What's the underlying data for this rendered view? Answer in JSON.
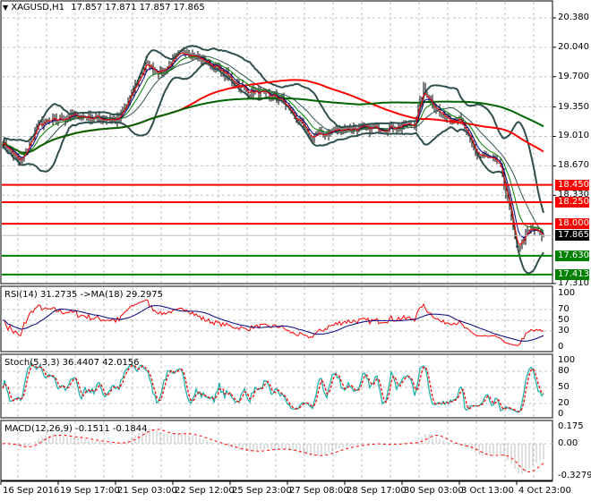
{
  "header": {
    "symbol": "XAGUSD,H1",
    "ohlc": "17.857 17.871 17.857 17.865"
  },
  "colors": {
    "bars": "#000000",
    "resistance": "#ff0000",
    "support": "#008000",
    "bollinger": "#2f4f4f",
    "ma_fast": "#ff0000",
    "ma_mid": "#000080",
    "ma_slow": "#008000",
    "ma_long": "#ff0000",
    "ma_longest": "#006400",
    "rsi": "#ff0000",
    "rsi_ma": "#000080",
    "stoch_main": "#20b2aa",
    "stoch_signal": "#ff0000",
    "macd_hist": "#c0c0c0",
    "macd_signal": "#ff0000"
  },
  "price_axis": [
    "20.380",
    "20.040",
    "19.700",
    "19.350",
    "19.010",
    "18.670",
    "18.330",
    "17.310"
  ],
  "price_axis_values": [
    20.38,
    20.04,
    19.7,
    19.35,
    19.01,
    18.67,
    18.33,
    17.31
  ],
  "levels": [
    {
      "label": "18.450",
      "value": 18.45,
      "type": "resistance"
    },
    {
      "label": "18.250",
      "value": 18.25,
      "type": "resistance"
    },
    {
      "label": "18.000",
      "value": 18.0,
      "type": "resistance"
    },
    {
      "label": "17.630",
      "value": 17.63,
      "type": "support"
    },
    {
      "label": "17.413",
      "value": 17.413,
      "type": "support"
    }
  ],
  "current_price": {
    "label": "17.865",
    "value": 17.865
  },
  "rsi": {
    "title": "RSI(14) 31.2735  ->MA(18) 29.2975",
    "axis": [
      "100",
      "70",
      "50",
      "30",
      "0"
    ],
    "axis_values": [
      100,
      70,
      50,
      30,
      0
    ]
  },
  "stoch": {
    "title": "Stoch(5,3,3) 36.4407 42.0156",
    "axis": [
      "100",
      "80",
      "50",
      "20",
      "0"
    ],
    "axis_values": [
      100,
      80,
      50,
      20,
      0
    ]
  },
  "macd": {
    "title": "MACD(12,26,9) -0.1511 -0.1844",
    "axis": [
      "0.175",
      "0.00",
      "-0.3279"
    ],
    "axis_values": [
      0.175,
      0,
      -0.3279
    ]
  },
  "time_axis": [
    "16 Sep 2016",
    "19 Sep 17:00",
    "21 Sep 03:00",
    "22 Sep 12:00",
    "25 Sep 23:00",
    "27 Sep 08:00",
    "28 Sep 17:00",
    "30 Sep 03:00",
    "3 Oct 13:00",
    "4 Oct 23:00"
  ],
  "chart_data": {
    "type": "ohlc-bars",
    "timeframe": "H1",
    "anchor_closes": [
      [
        0,
        18.95
      ],
      [
        10,
        18.7
      ],
      [
        20,
        19.15
      ],
      [
        40,
        19.25
      ],
      [
        65,
        19.2
      ],
      [
        80,
        19.85
      ],
      [
        88,
        19.75
      ],
      [
        102,
        20.0
      ],
      [
        120,
        19.8
      ],
      [
        135,
        19.55
      ],
      [
        155,
        19.45
      ],
      [
        172,
        19.0
      ],
      [
        190,
        19.1
      ],
      [
        210,
        19.1
      ],
      [
        230,
        19.15
      ],
      [
        235,
        19.55
      ],
      [
        245,
        19.25
      ],
      [
        255,
        19.2
      ],
      [
        265,
        18.8
      ],
      [
        277,
        18.7
      ],
      [
        282,
        18.3
      ],
      [
        287,
        17.7
      ],
      [
        295,
        17.95
      ],
      [
        302,
        17.865
      ]
    ]
  }
}
